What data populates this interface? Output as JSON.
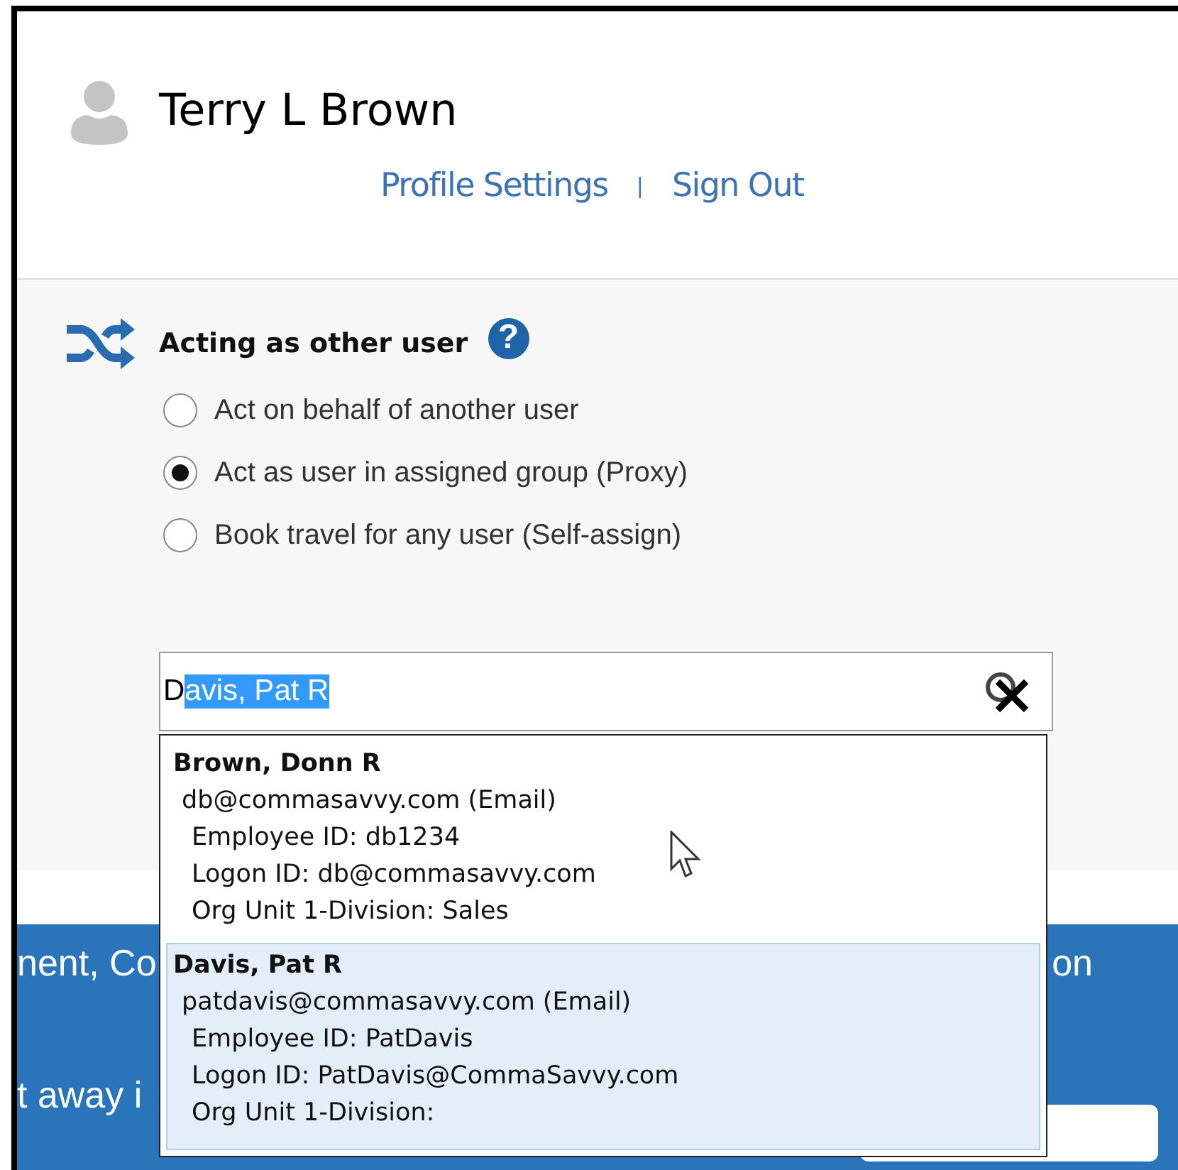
{
  "user": {
    "name": "Terry L Brown"
  },
  "links": [
    "Profile Settings",
    "Sign Out"
  ],
  "separator": "|",
  "section": {
    "title": "Acting as other user",
    "help": "?"
  },
  "options": [
    {
      "label": "Act on behalf of another user",
      "selected": false
    },
    {
      "label": "Act as user in assigned group (Proxy)",
      "selected": true
    },
    {
      "label": "Book travel for any user (Self-assign)",
      "selected": false
    }
  ],
  "search": {
    "typed": "D",
    "autocompleted": "avis, Pat R"
  },
  "suggestions": [
    {
      "name": "Brown, Donn R",
      "email": "db@commasavvy.com (Email)",
      "details": [
        "Employee ID: db1234",
        "Logon ID: db@commasavvy.com",
        "Org Unit 1-Division: Sales"
      ],
      "selected": false
    },
    {
      "name": "Davis, Pat R",
      "email": "patdavis@commasavvy.com (Email)",
      "details": [
        "Employee ID: PatDavis",
        "Logon ID: PatDavis@CommaSavvy.com",
        "Org Unit 1-Division:"
      ],
      "selected": true
    }
  ],
  "banner": {
    "line_1_left": "nent, Co",
    "line_1_right": "on",
    "line_2_left": "t away i"
  }
}
